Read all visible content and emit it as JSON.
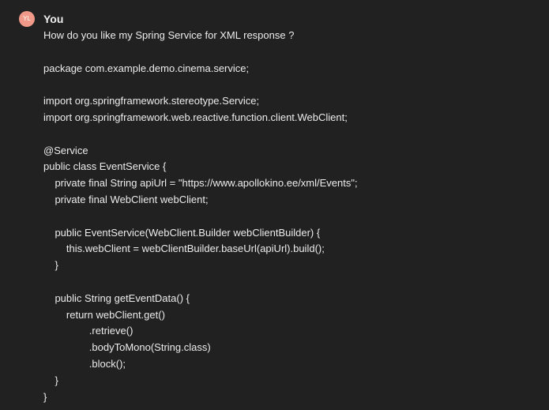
{
  "avatar": {
    "initials": "YL",
    "color": "#f29a8a"
  },
  "author": "You",
  "question": "How do you like my Spring Service for XML response ?",
  "code_lines": [
    "",
    "package com.example.demo.cinema.service;",
    "",
    "import org.springframework.stereotype.Service;",
    "import org.springframework.web.reactive.function.client.WebClient;",
    "",
    "@Service",
    "public class EventService {",
    "    private final String apiUrl = \"https://www.apollokino.ee/xml/Events\";",
    "    private final WebClient webClient;",
    "",
    "    public EventService(WebClient.Builder webClientBuilder) {",
    "        this.webClient = webClientBuilder.baseUrl(apiUrl).build();",
    "    }",
    "",
    "    public String getEventData() {",
    "        return webClient.get()",
    "                .retrieve()",
    "                .bodyToMono(String.class)",
    "                .block();",
    "    }",
    "}"
  ]
}
